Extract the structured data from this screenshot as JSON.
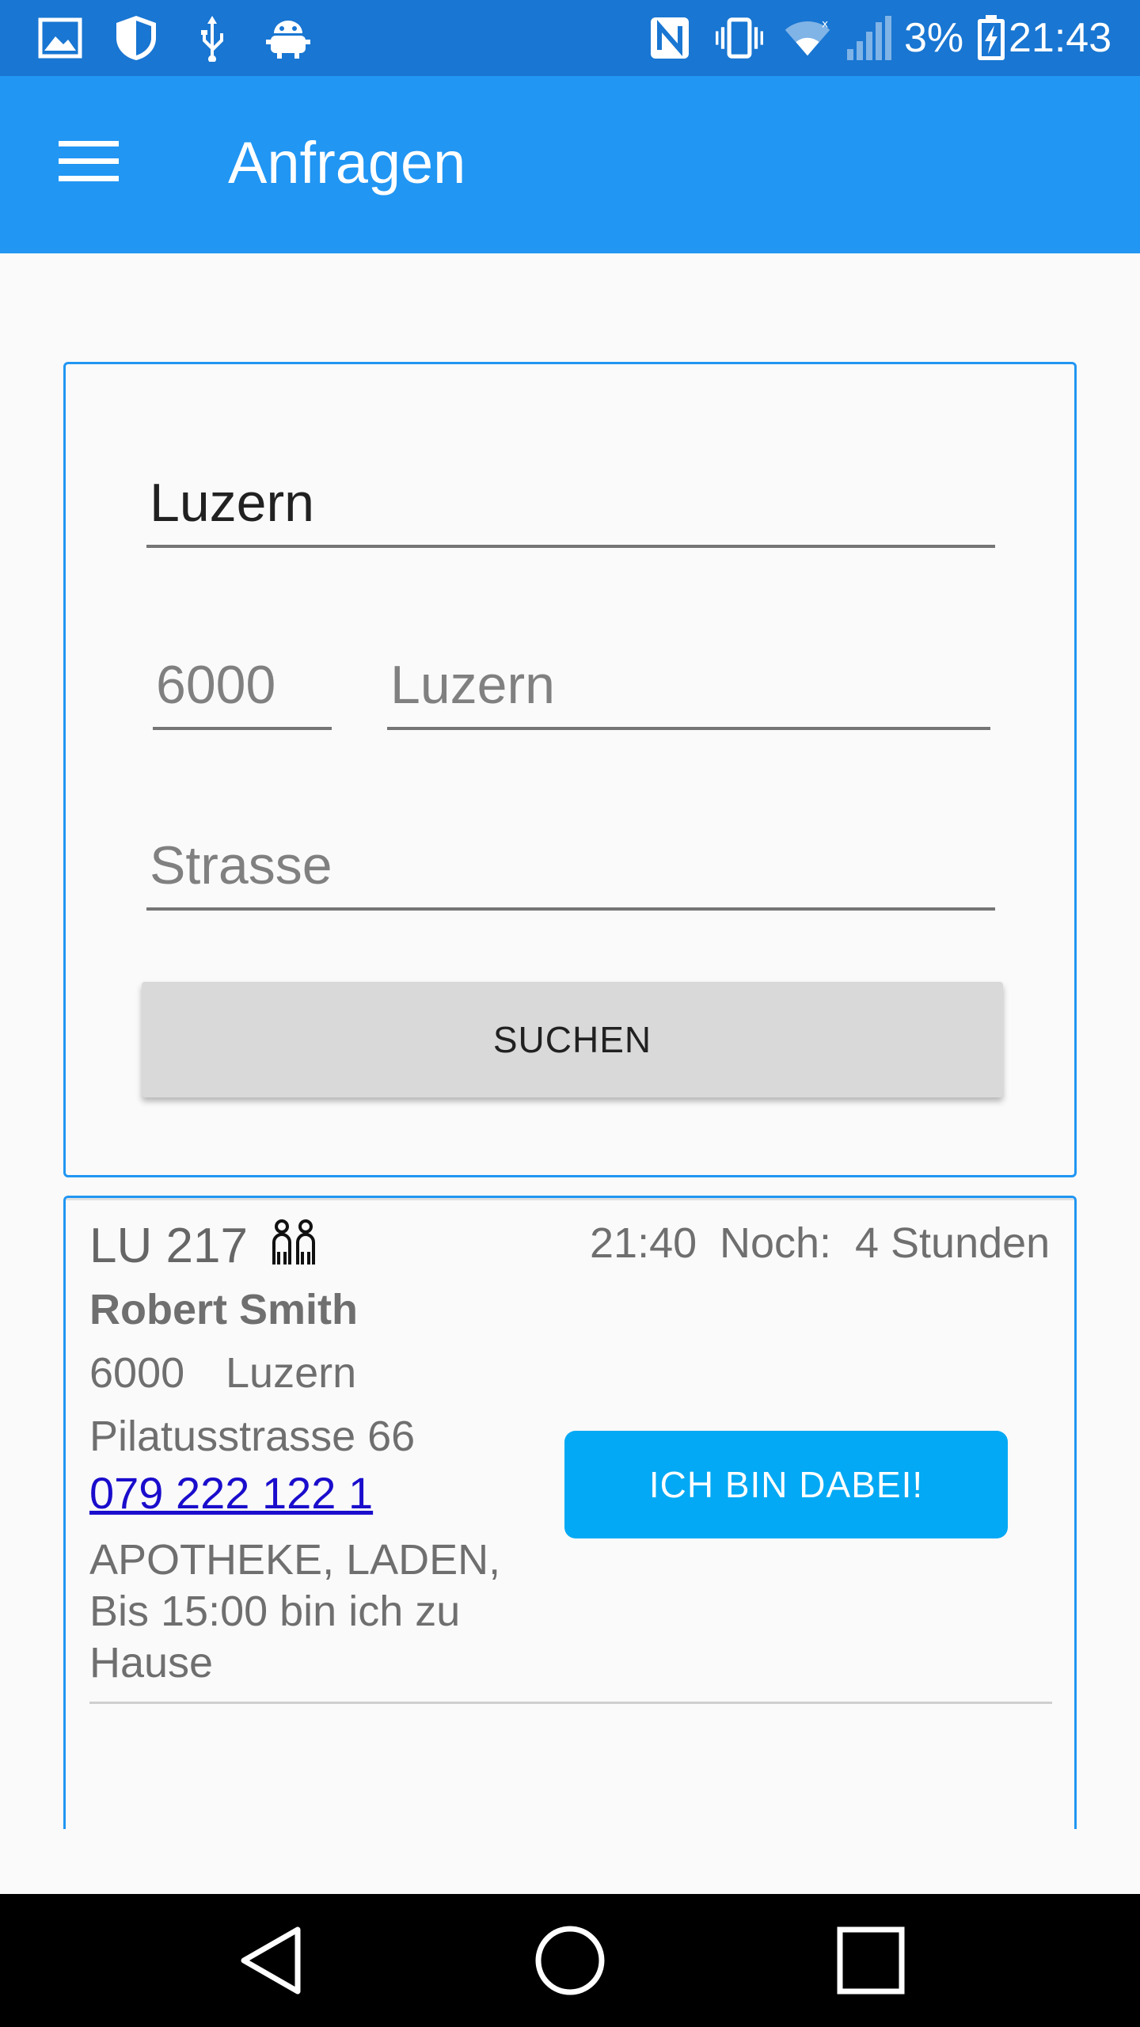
{
  "status_bar": {
    "battery_percent": "3%",
    "time": "21:43",
    "icons": [
      "gallery-icon",
      "shield-icon",
      "usb-icon",
      "android-debug-icon",
      "nfc-icon",
      "vibrate-icon",
      "wifi-icon",
      "signal-icon",
      "battery-charging-icon"
    ]
  },
  "app_bar": {
    "title": "Anfragen",
    "menu_icon": "hamburger-menu-icon"
  },
  "search": {
    "city_value": "Luzern",
    "zip_value": "6000",
    "place_value": "Luzern",
    "street_placeholder": "Strasse",
    "button_label": "SUCHEN"
  },
  "results": [
    {
      "id": "LU 217",
      "people_icon": "people-icon",
      "time": "21:40",
      "remaining_label": "Noch:",
      "remaining_value": "4 Stunden",
      "name": "Robert Smith",
      "zip": "6000",
      "city": "Luzern",
      "street": "Pilatusstrasse 66",
      "phone": "079 222 122 1",
      "notes": "APOTHEKE, LADEN, Bis 15:00 bin ich zu Hause",
      "action_label": "ICH BIN DABEI!"
    }
  ],
  "nav_bar": {
    "icons": [
      "back-icon",
      "home-icon",
      "recents-icon"
    ]
  },
  "colors": {
    "status_bar": "#1976d2",
    "app_bar": "#2196f3",
    "card_border": "#2196f3",
    "action_button": "#03a9f4",
    "link": "#1a0dcc"
  }
}
